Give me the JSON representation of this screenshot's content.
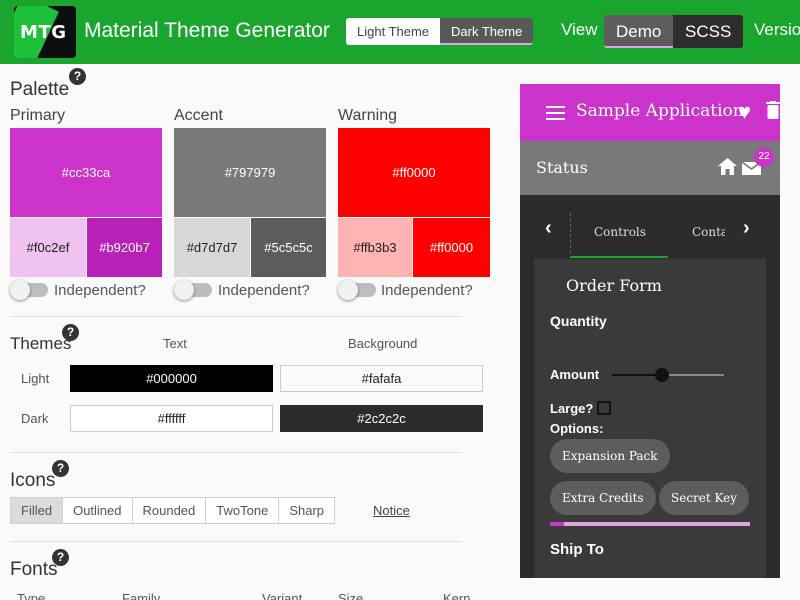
{
  "app": {
    "logo_text": "MTG",
    "title": "Material Theme Generator",
    "theme_toggle": {
      "light": "Light Theme",
      "dark": "Dark Theme",
      "selected": "Dark Theme"
    },
    "view_label": "View",
    "view_tabs": {
      "demo": "Demo",
      "scss": "SCSS",
      "selected": "Demo"
    },
    "version_label": "Version"
  },
  "palette": {
    "title": "Palette",
    "help": "?",
    "columns": [
      {
        "label": "Primary",
        "main": "#cc33ca",
        "light": "#f0c2ef",
        "dark": "#b920b7",
        "toggle_label": "Independent?",
        "toggle_on": false
      },
      {
        "label": "Accent",
        "main": "#797979",
        "light": "#d7d7d7",
        "dark": "#5c5c5c",
        "toggle_label": "Independent?",
        "toggle_on": false
      },
      {
        "label": "Warning",
        "main": "#ff0000",
        "light": "#ffb3b3",
        "dark": "#ff0000",
        "toggle_label": "Independent?",
        "toggle_on": false
      }
    ]
  },
  "themes": {
    "title": "Themes",
    "help": "?",
    "text_header": "Text",
    "background_header": "Background",
    "light_label": "Light",
    "dark_label": "Dark",
    "light_text": "#000000",
    "light_background": "#fafafa",
    "dark_text": "#ffffff",
    "dark_background": "#2c2c2c"
  },
  "icons": {
    "title": "Icons",
    "help": "?",
    "options": [
      "Filled",
      "Outlined",
      "Rounded",
      "TwoTone",
      "Sharp"
    ],
    "selected": "Filled",
    "notice_link": "Notice"
  },
  "fonts": {
    "title": "Fonts",
    "help": "?",
    "headers": [
      "Type",
      "Family",
      "Variant",
      "Size",
      "Kern"
    ]
  },
  "demo": {
    "app_title": "Sample Application",
    "status_title": "Status",
    "mail_badge": "22",
    "tabs": [
      "Controls",
      "Containers"
    ],
    "selected_tab": "Controls",
    "form_title": "Order Form",
    "quantity_label": "Quantity",
    "amount_label": "Amount",
    "amount_fraction": 0.45,
    "large_label": "Large?",
    "large_checked": false,
    "options_label": "Options:",
    "chips": [
      "Expansion Pack",
      "Extra Credits",
      "Secret Key"
    ],
    "progress_fraction": 0.07,
    "ship_to_label": "Ship To"
  },
  "colors": {
    "brand_green": "#1aa52e",
    "primary": "#cc33ca",
    "accent": "#797979",
    "dark_background": "#2c2c2c"
  }
}
